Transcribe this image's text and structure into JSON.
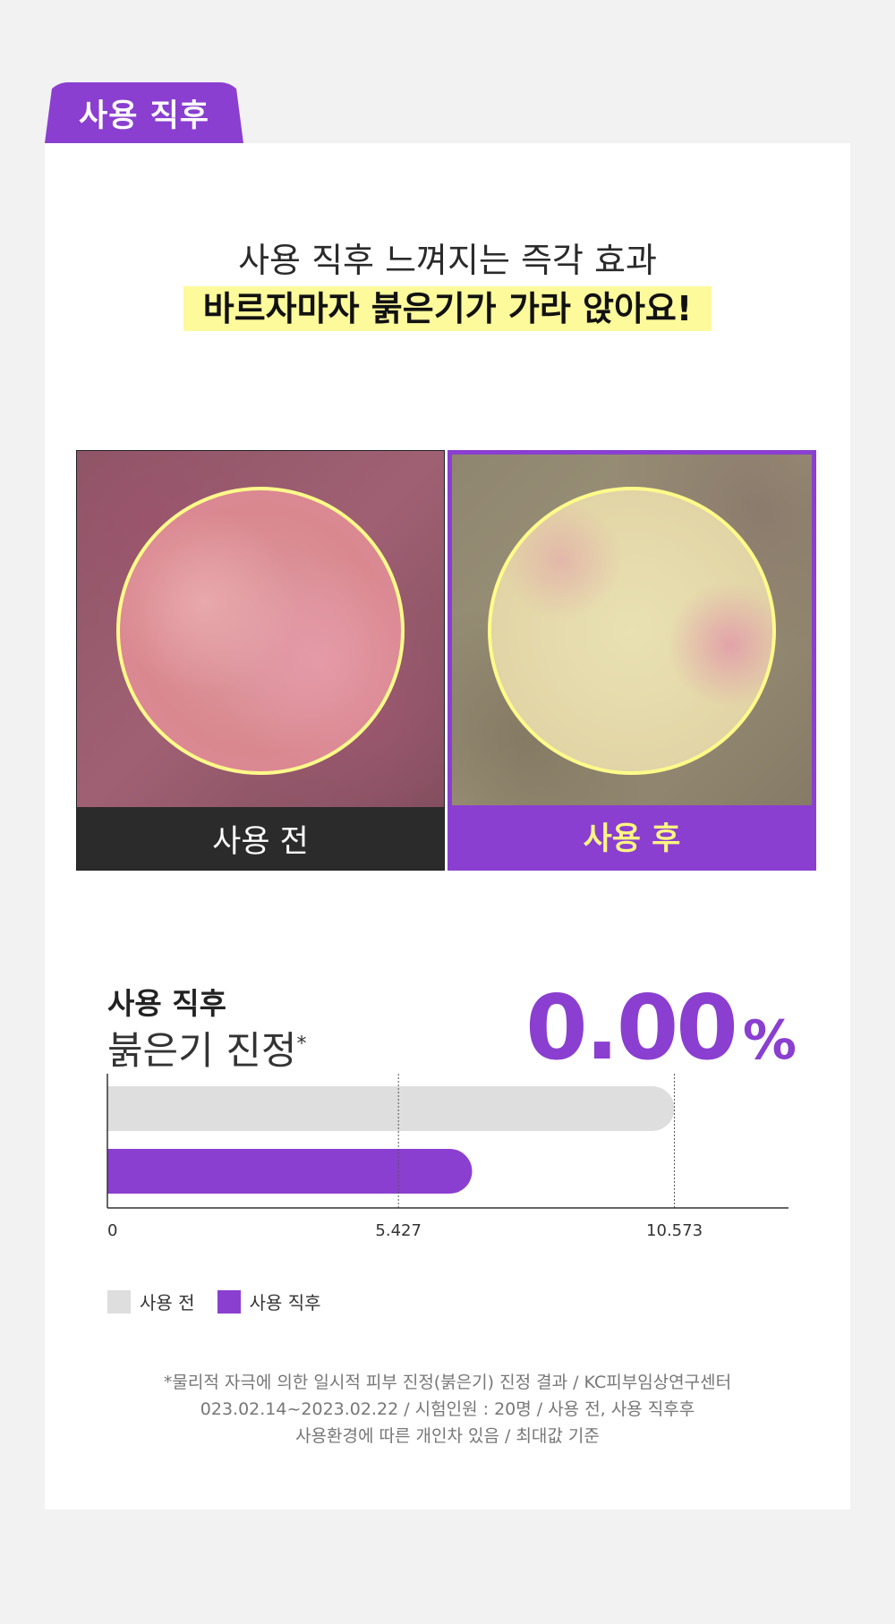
{
  "tab_label": "사용 직후",
  "heading": "사용 직후 느껴지는 즉각 효과",
  "highlight": "바르자마자 붉은기가 가라 앉아요!",
  "photos": {
    "before_label": "사용 전",
    "after_label": "사용 후"
  },
  "metric": {
    "title_line1": "사용 직후",
    "title_line2": "붉은기 진정",
    "title_mark": "*",
    "value": "0.00",
    "unit": "%"
  },
  "colors": {
    "accent": "#8a3fd0",
    "highlight": "#fdfa9b",
    "before_bar": "#dedede"
  },
  "chart_data": {
    "type": "bar",
    "orientation": "horizontal",
    "series": [
      {
        "name": "사용 전",
        "value": 10.573,
        "color": "#dedede"
      },
      {
        "name": "사용 직후",
        "value": 6.8,
        "color": "#8a3fd0"
      }
    ],
    "reference_lines": [
      5.427,
      10.573
    ],
    "x_ticks": [
      "0",
      "5.427",
      "10.573"
    ],
    "x_tick_values": [
      0,
      5.427,
      10.573
    ],
    "xlim": [
      0,
      12.7
    ]
  },
  "legend": [
    {
      "label": "사용 전",
      "color": "#dedede"
    },
    {
      "label": "사용 직후",
      "color": "#8a3fd0"
    }
  ],
  "footnote": [
    "*물리적 자극에 의한 일시적 피부 진정(붉은기) 진정 결과 / KC피부임상연구센터",
    "023.02.14~2023.02.22 / 시험인원 : 20명 / 사용 전, 사용 직후후",
    "사용환경에 따른 개인차 있음 / 최대값 기준"
  ]
}
